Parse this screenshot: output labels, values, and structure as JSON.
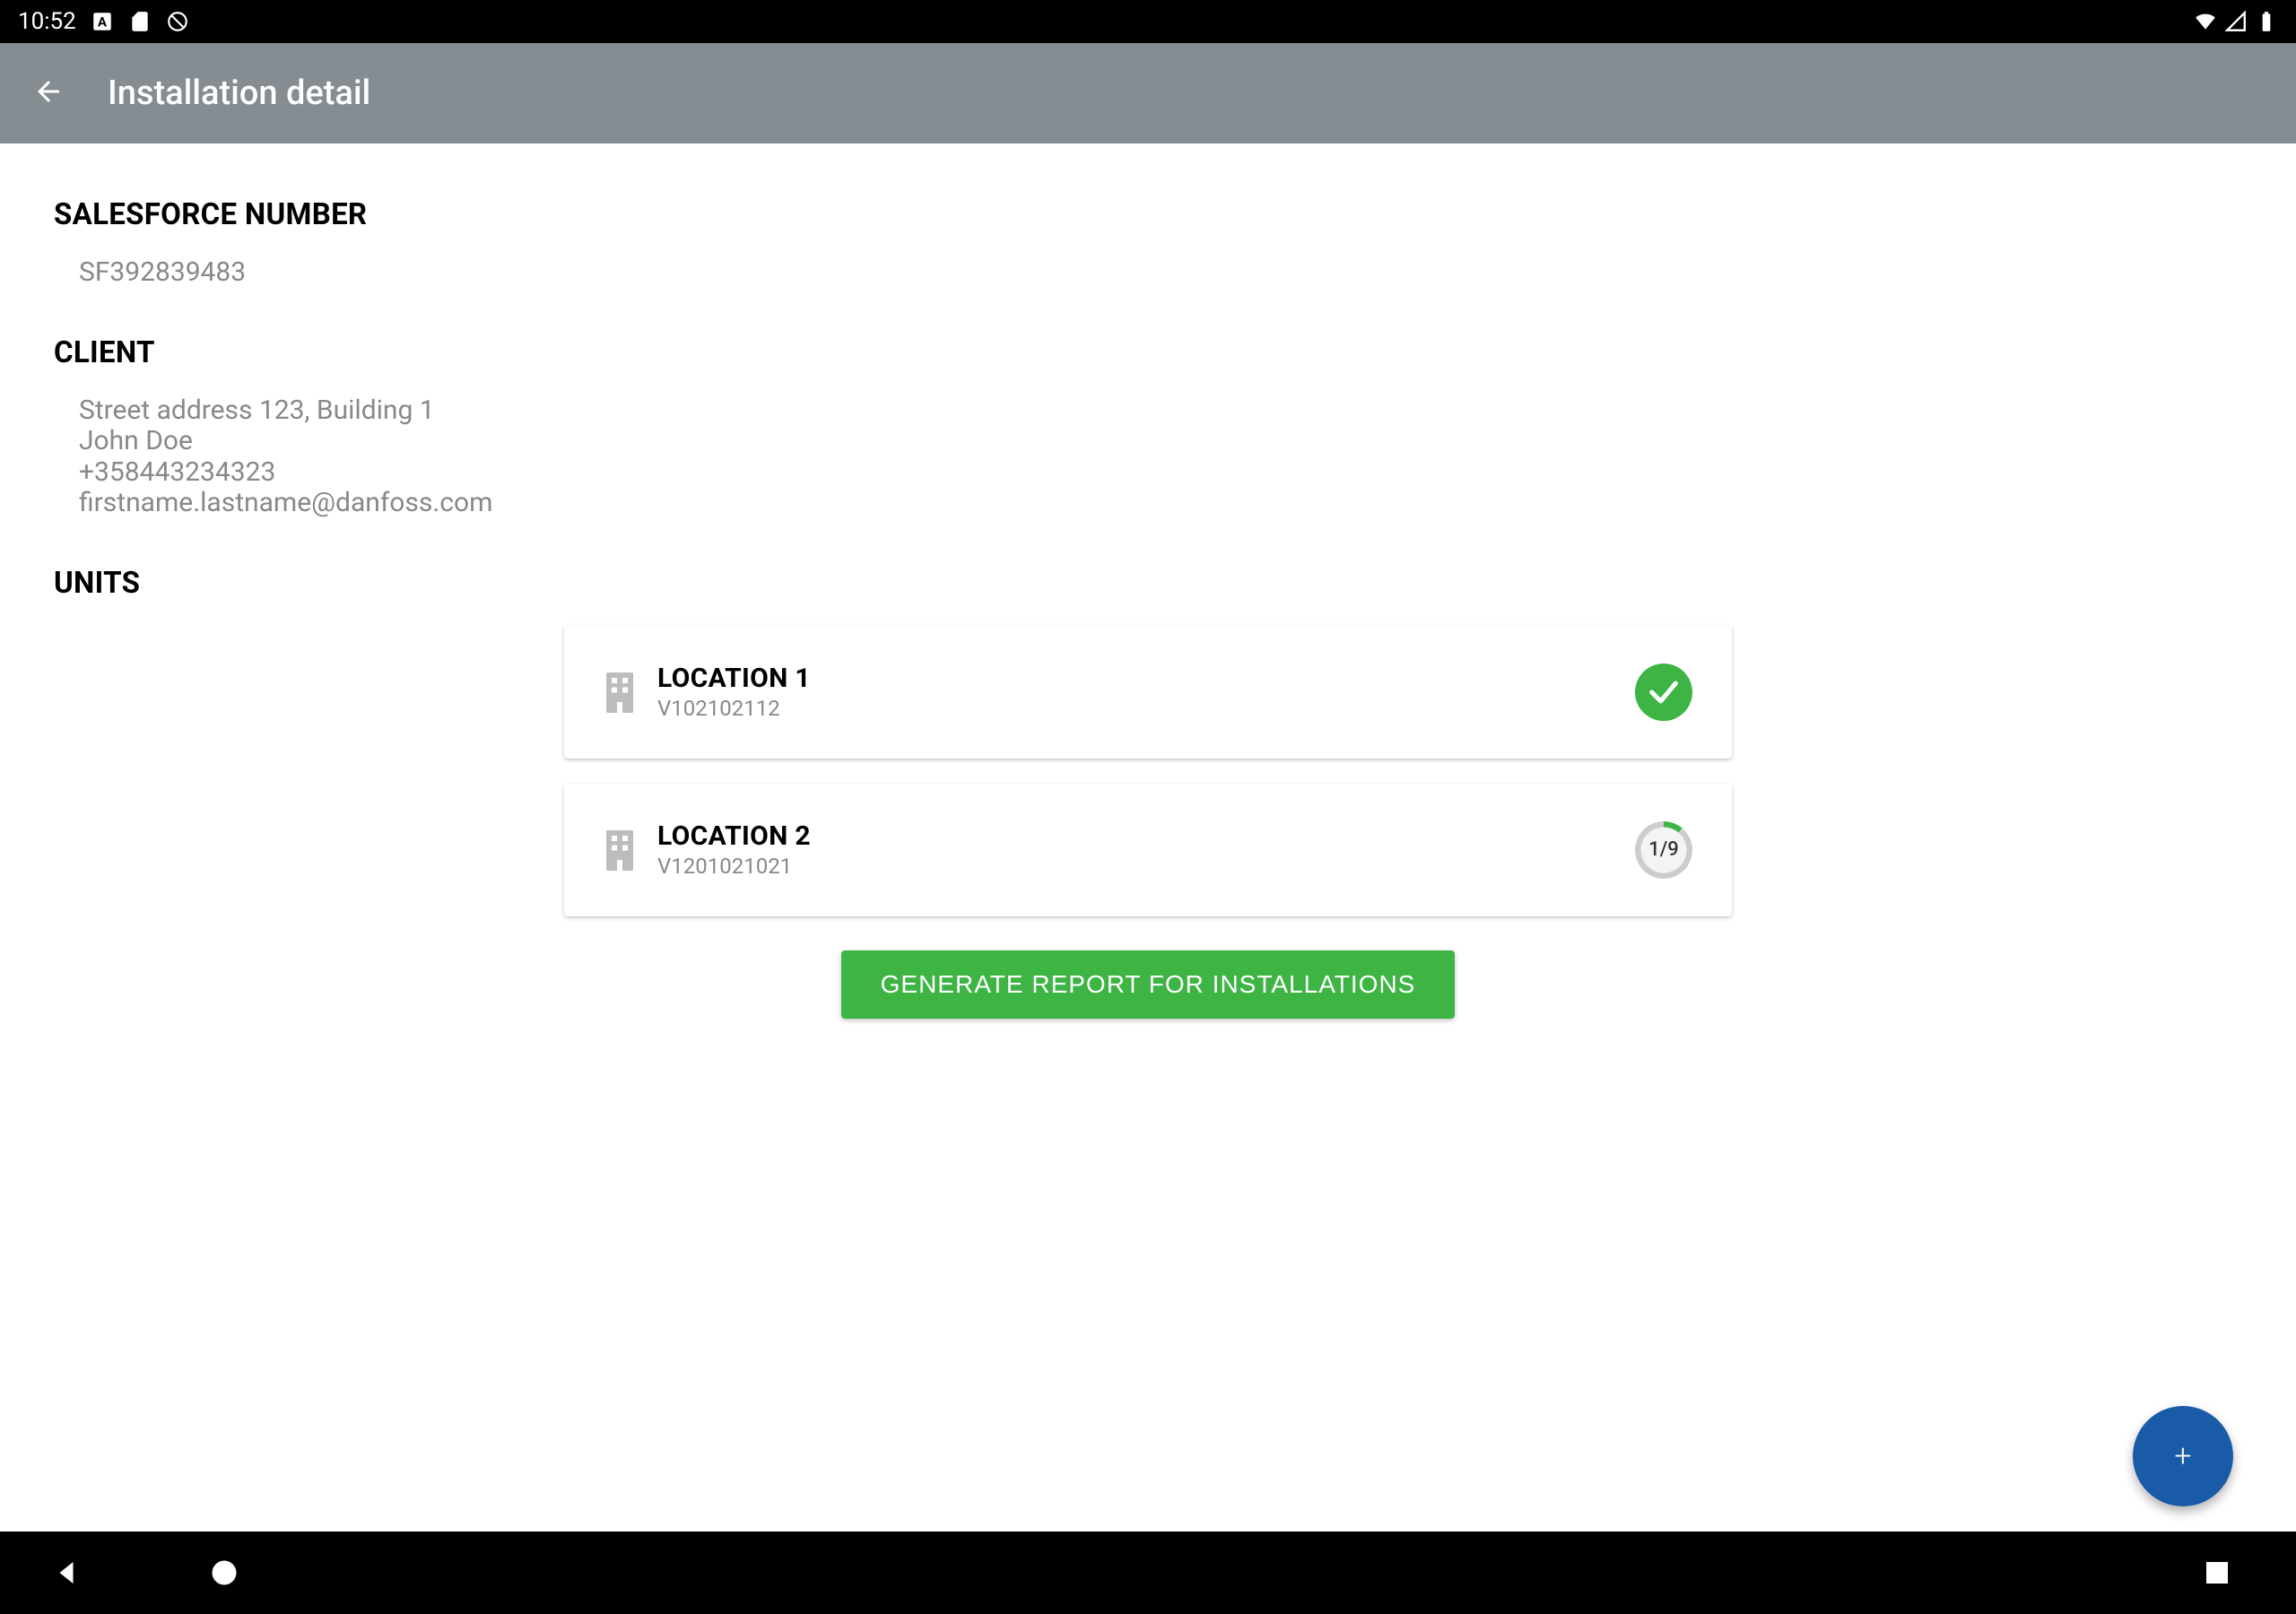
{
  "status_bar": {
    "time": "10:52"
  },
  "app_bar": {
    "title": "Installation detail"
  },
  "sections": {
    "salesforce": {
      "heading": "SALESFORCE NUMBER",
      "value": "SF392839483"
    },
    "client": {
      "heading": "CLIENT",
      "address": "Street address 123, Building 1",
      "name": "John Doe",
      "phone": "+358443234323",
      "email": "firstname.lastname@danfoss.com"
    },
    "units": {
      "heading": "UNITS"
    }
  },
  "units": [
    {
      "name": "LOCATION 1",
      "serial": "V102102112",
      "status": "complete"
    },
    {
      "name": "LOCATION 2",
      "serial": "V1201021021",
      "status": "progress",
      "progress_text": "1/9"
    }
  ],
  "buttons": {
    "generate_report": "GENERATE REPORT FOR INSTALLATIONS",
    "fab": "+"
  }
}
